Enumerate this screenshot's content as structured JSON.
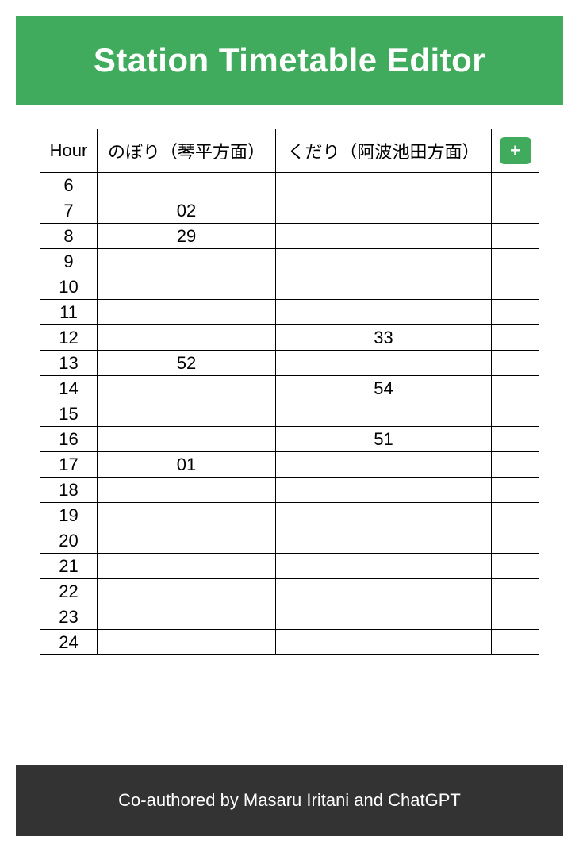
{
  "header": {
    "title": "Station Timetable Editor"
  },
  "table": {
    "columns": {
      "hour": "Hour",
      "direction1": "のぼり（琴平方面）",
      "direction2": "くだり（阿波池田方面）"
    },
    "add_button_label": "+",
    "rows": [
      {
        "hour": "6",
        "d1": "",
        "d2": ""
      },
      {
        "hour": "7",
        "d1": "02",
        "d2": ""
      },
      {
        "hour": "8",
        "d1": "29",
        "d2": ""
      },
      {
        "hour": "9",
        "d1": "",
        "d2": ""
      },
      {
        "hour": "10",
        "d1": "",
        "d2": ""
      },
      {
        "hour": "11",
        "d1": "",
        "d2": ""
      },
      {
        "hour": "12",
        "d1": "",
        "d2": "33"
      },
      {
        "hour": "13",
        "d1": "52",
        "d2": ""
      },
      {
        "hour": "14",
        "d1": "",
        "d2": "54"
      },
      {
        "hour": "15",
        "d1": "",
        "d2": ""
      },
      {
        "hour": "16",
        "d1": "",
        "d2": "51"
      },
      {
        "hour": "17",
        "d1": "01",
        "d2": ""
      },
      {
        "hour": "18",
        "d1": "",
        "d2": ""
      },
      {
        "hour": "19",
        "d1": "",
        "d2": ""
      },
      {
        "hour": "20",
        "d1": "",
        "d2": ""
      },
      {
        "hour": "21",
        "d1": "",
        "d2": ""
      },
      {
        "hour": "22",
        "d1": "",
        "d2": ""
      },
      {
        "hour": "23",
        "d1": "",
        "d2": ""
      },
      {
        "hour": "24",
        "d1": "",
        "d2": ""
      }
    ]
  },
  "footer": {
    "text": "Co-authored by Masaru Iritani and ChatGPT"
  }
}
